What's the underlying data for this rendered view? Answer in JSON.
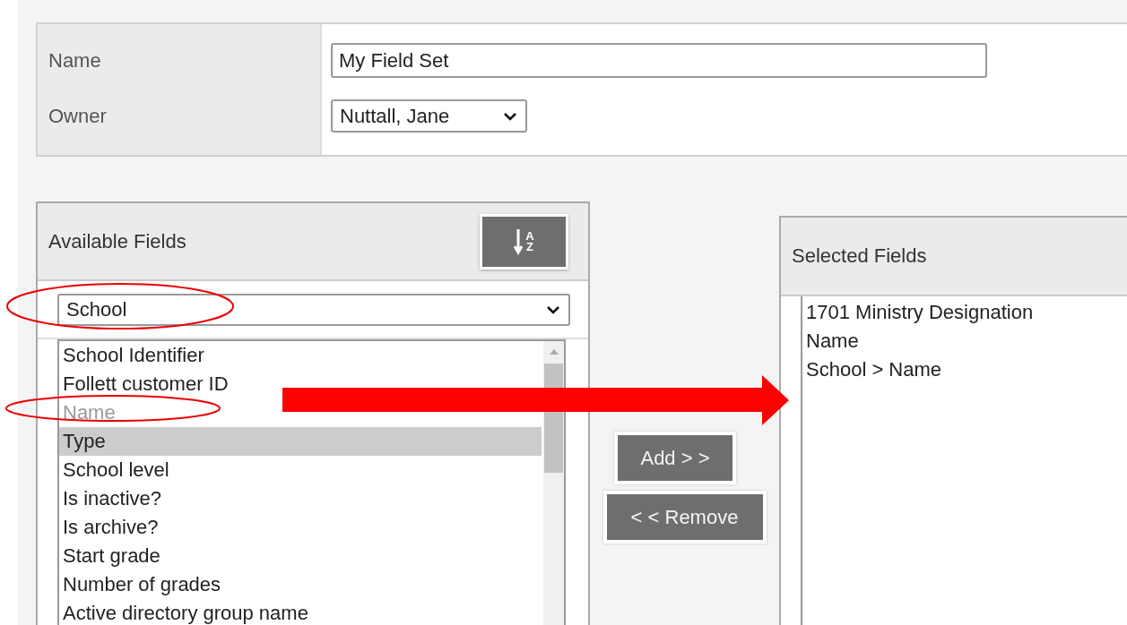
{
  "form": {
    "fields": [
      {
        "kind": "text",
        "label": "Name",
        "value": "My Field Set"
      },
      {
        "kind": "select",
        "label": "Owner",
        "value": "Nuttall, Jane"
      }
    ]
  },
  "available_fields": {
    "title": "Available Fields",
    "sort_button": {
      "letters": [
        "A",
        "Z"
      ]
    },
    "table_select": "School",
    "items": [
      {
        "label": "School Identifier",
        "selected": false,
        "disabled": false
      },
      {
        "label": "Follett customer ID",
        "selected": false,
        "disabled": false
      },
      {
        "label": "Name",
        "selected": false,
        "disabled": true
      },
      {
        "label": "Type",
        "selected": true,
        "disabled": false
      },
      {
        "label": "School level",
        "selected": false,
        "disabled": false
      },
      {
        "label": "Is inactive?",
        "selected": false,
        "disabled": false
      },
      {
        "label": "Is archive?",
        "selected": false,
        "disabled": false
      },
      {
        "label": "Start grade",
        "selected": false,
        "disabled": false
      },
      {
        "label": "Number of grades",
        "selected": false,
        "disabled": false
      },
      {
        "label": "Active directory group name",
        "selected": false,
        "disabled": false
      }
    ]
  },
  "buttons": [
    "Add > >",
    "< < Remove"
  ],
  "selected_fields": {
    "title": "Selected Fields",
    "items": [
      "1701 Ministry Designation",
      "Name",
      "School > Name"
    ]
  }
}
